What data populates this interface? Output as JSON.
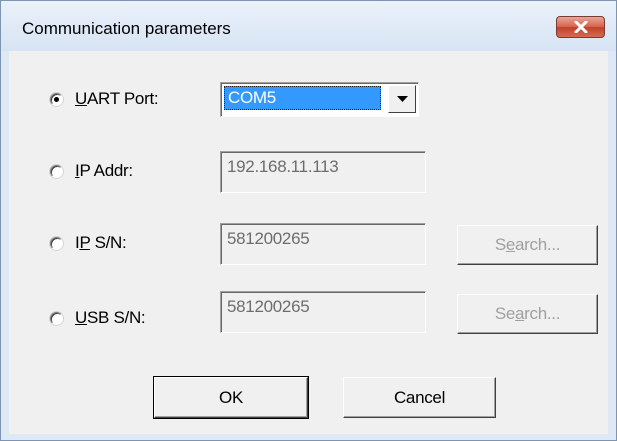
{
  "window": {
    "title": "Communication parameters",
    "close_icon": "close-icon"
  },
  "rows": [
    {
      "key": "uart",
      "selected": true,
      "label_pre": "",
      "label_accel": "U",
      "label_post": "ART Port:",
      "value": "COM5",
      "control": "combobox",
      "dropdown_icon": "chevron-down-icon"
    },
    {
      "key": "ip-addr",
      "selected": false,
      "label_pre": "",
      "label_accel": "I",
      "label_post": "P Addr:",
      "value": "192.168.11.113",
      "control": "textbox-disabled"
    },
    {
      "key": "ip-sn",
      "selected": false,
      "label_pre": "I",
      "label_accel": "P",
      "label_post": " S/N:",
      "value": "581200265",
      "control": "textbox-disabled",
      "search": {
        "pre": "S",
        "accel": "e",
        "post": "arch...",
        "enabled": false
      }
    },
    {
      "key": "usb-sn",
      "selected": false,
      "label_pre": "",
      "label_accel": "U",
      "label_post": "SB S/N:",
      "value": "581200265",
      "control": "textbox-disabled",
      "search": {
        "pre": "Se",
        "accel": "a",
        "post": "rch...",
        "enabled": false
      }
    }
  ],
  "buttons": {
    "ok": "OK",
    "cancel": "Cancel"
  },
  "colors": {
    "selection": "#3399ff",
    "close_button": "#c1402a",
    "dialog_face": "#f0f0f0"
  }
}
